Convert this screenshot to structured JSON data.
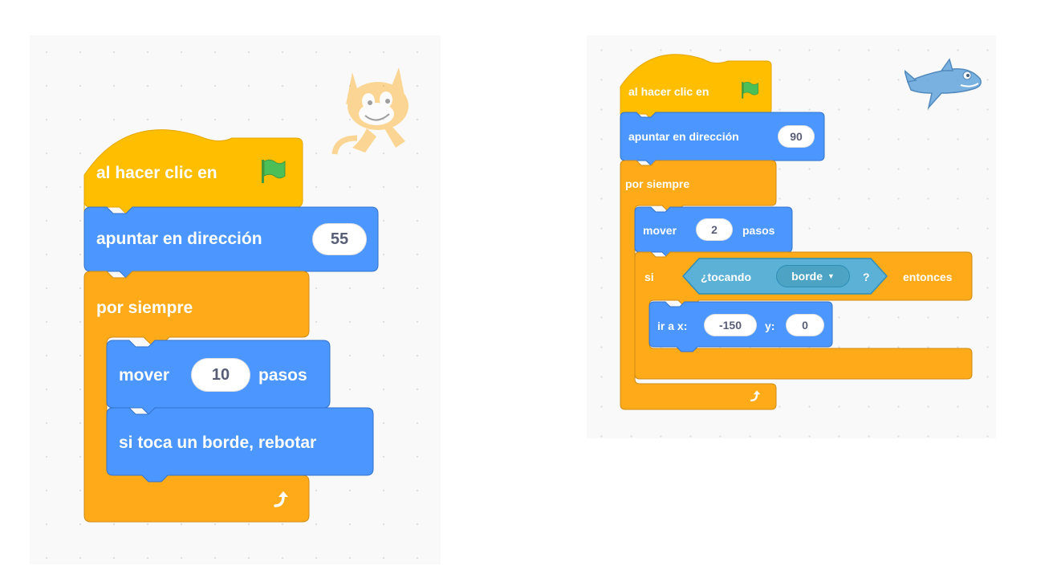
{
  "colors": {
    "events": "#ffbf00",
    "events_dark": "#e6a600",
    "motion": "#4c97ff",
    "motion_dark": "#3373cc",
    "control": "#ffab19",
    "control_dark": "#cf8b17",
    "sensing": "#5cb1d6",
    "sensing_dark": "#2e8eb8",
    "flag": "#4cbf56"
  },
  "left_script": {
    "sprite_icon": "cat-sprite-icon",
    "hat": {
      "label": "al hacer clic en",
      "icon": "green-flag-icon"
    },
    "point": {
      "label": "apuntar en dirección",
      "value": "55"
    },
    "forever": {
      "label": "por siempre",
      "icon": "loop-arrow-icon"
    },
    "move": {
      "label": "mover",
      "value": "10",
      "suffix": "pasos"
    },
    "bounce": {
      "label": "si toca un borde, rebotar"
    }
  },
  "right_script": {
    "sprite_icon": "shark-sprite-icon",
    "hat": {
      "label": "al hacer clic en",
      "icon": "green-flag-icon"
    },
    "point": {
      "label": "apuntar en dirección",
      "value": "90"
    },
    "forever": {
      "label": "por siempre",
      "icon": "loop-arrow-icon"
    },
    "move": {
      "label": "mover",
      "value": "2",
      "suffix": "pasos"
    },
    "if": {
      "label": "si",
      "condition_label": "¿tocando",
      "condition_menu": "borde",
      "question": "?",
      "then_label": "entonces"
    },
    "goto": {
      "label": "ir a x:",
      "x_value": "-150",
      "y_label": "y:",
      "y_value": "0"
    }
  }
}
